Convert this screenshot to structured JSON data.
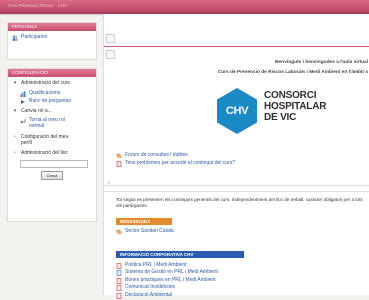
{
  "topbar": {
    "breadcrumb": "Curs Prevenció Riscos · CHV"
  },
  "sidebar": {
    "persones": {
      "title": "PERSONES",
      "items": [
        {
          "label": "Participants"
        }
      ]
    },
    "configuracio": {
      "title": "CONFIGURACIÓ",
      "items": [
        {
          "label": "Administració del curs",
          "children": [
            {
              "label": "Qualificacions"
            },
            {
              "label": "Banc de preguntes"
            }
          ]
        },
        {
          "label": "Canvia rol a...",
          "children": [
            {
              "label": "Torna al meu rol normal"
            }
          ]
        },
        {
          "label": "Configuració del meu perfil"
        },
        {
          "label": "Administració del lloc"
        }
      ],
      "search_button": "Cerca"
    }
  },
  "main": {
    "welcome_lines": [
      "Benvinguts i benvingudes a l'aula virtual",
      "Curs de Prevenció de Riscos Laborals i Medi Ambient en l'àmbit s"
    ],
    "logo": {
      "mark": "CHV",
      "line1": "CONSORCI",
      "line2": "HOSPITALAR",
      "line3": "DE VIC"
    },
    "links": [
      {
        "label": "Fòrum de consultes i dubtes"
      },
      {
        "label": "Tens problemes per accedir al contingut del curs?"
      }
    ],
    "intro_text": "Tot seguit es presenten els continguts generals del curs. Independentment del lloc de treball, caràcter obligatori per a tots els participants.",
    "sections": [
      {
        "title": "BENVINGUDA",
        "items": [
          {
            "label": "Sector Sanitari Català"
          }
        ]
      },
      {
        "title": "INFORMACIÓ CORPORATIVA CHV",
        "items": [
          {
            "label": "Política PRL i Medi Ambient"
          },
          {
            "label": "Sistema de Gestió en PRL i Medi Ambient"
          },
          {
            "label": "Bones pràctiques en PRL i Medi Ambient"
          },
          {
            "label": "Comunicat Incidències"
          },
          {
            "label": "Declaració Ambiental"
          }
        ]
      }
    ]
  },
  "colors": {
    "accent": "#c94e6e",
    "orange": "#e38a2c",
    "blue": "#2a5db2",
    "logo_blue": "#1b8ac4"
  }
}
